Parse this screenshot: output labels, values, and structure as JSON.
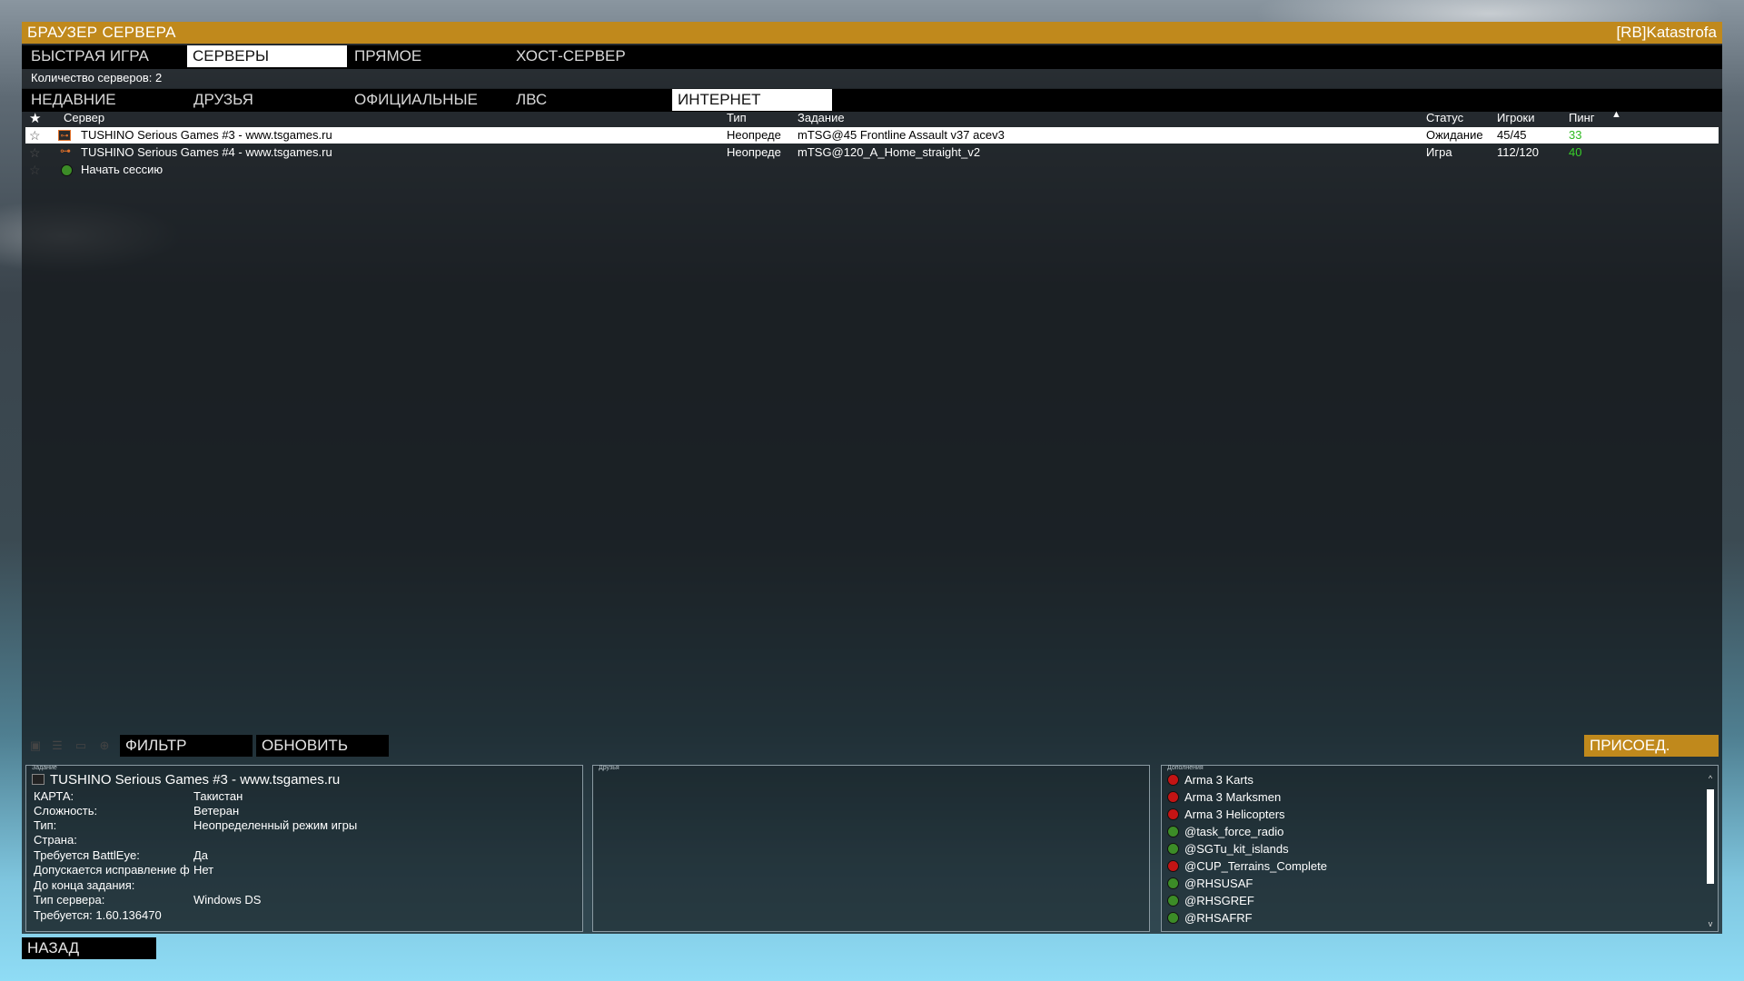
{
  "window": {
    "title": "БРАУЗЕР СЕРВЕРА",
    "user": "[RB]Katastrofa",
    "accent": "#c0891c"
  },
  "top_tabs": [
    {
      "label": "БЫСТРАЯ ИГРА",
      "active": false
    },
    {
      "label": "СЕРВЕРЫ",
      "active": true
    },
    {
      "label": "ПРЯМОЕ",
      "active": false
    },
    {
      "label": "ХОСТ-СЕРВЕР",
      "active": false
    }
  ],
  "server_count": "Количество серверов: 2",
  "source_tabs": [
    {
      "label": "НЕДАВНИЕ",
      "active": false
    },
    {
      "label": "ДРУЗЬЯ",
      "active": false
    },
    {
      "label": "ОФИЦИАЛЬНЫЕ",
      "active": false
    },
    {
      "label": "ЛВС",
      "active": false
    },
    {
      "label": "ИНТЕРНЕТ",
      "active": true
    }
  ],
  "columns": {
    "favorite_icon": "star-icon",
    "server": "Сервер",
    "type": "Тип",
    "mission": "Задание",
    "status": "Статус",
    "players": "Игроки",
    "ping": "Пинг",
    "sort_icon": "triangle-up-icon"
  },
  "servers": [
    {
      "name": "TUSHINO Serious Games #3 - www.tsgames.ru",
      "type": "Неопреде",
      "mission": "mTSG@45 Frontline Assault v37 acev3",
      "status": "Ожидание",
      "players": "45/45",
      "ping": "33",
      "locked": true,
      "selected": true
    },
    {
      "name": "TUSHINO Serious Games #4 - www.tsgames.ru",
      "type": "Неопреде",
      "mission": "mTSG@120_A_Home_straight_v2",
      "status": "Игра",
      "players": "112/120",
      "ping": "40",
      "locked": true,
      "selected": false
    }
  ],
  "start_session": "Начать сессию",
  "toolbar": {
    "filter": "ФИЛЬТР",
    "refresh": "ОБНОВИТЬ",
    "join": "ПРИСОЕД."
  },
  "details": {
    "legend": "Задание",
    "server_name": "TUSHINO Serious Games #3 - www.tsgames.ru",
    "rows": [
      {
        "k": "КАРТА:",
        "v": "Такистан"
      },
      {
        "k": "Сложность:",
        "v": "Ветеран"
      },
      {
        "k": "Тип:",
        "v": "Неопределенный режим игры"
      },
      {
        "k": "Страна:",
        "v": ""
      },
      {
        "k": "Требуется BattlEye:",
        "v": "Да"
      },
      {
        "k": "Допускается исправление ф",
        "v": "Нет"
      },
      {
        "k": "До конца задания:",
        "v": ""
      },
      {
        "k": "Тип сервера:",
        "v": "Windows DS"
      },
      {
        "k": "Требуется: 1.60.136470",
        "v": ""
      }
    ]
  },
  "friends": {
    "legend": "Друзья"
  },
  "addons": {
    "legend": "Дополнения",
    "items": [
      {
        "name": "Arma 3 Karts",
        "status": "red"
      },
      {
        "name": "Arma 3 Marksmen",
        "status": "red"
      },
      {
        "name": "Arma 3 Helicopters",
        "status": "red"
      },
      {
        "name": "@task_force_radio",
        "status": "green"
      },
      {
        "name": "@SGTu_kit_islands",
        "status": "green"
      },
      {
        "name": "@CUP_Terrains_Complete",
        "status": "red"
      },
      {
        "name": "@RHSUSAF",
        "status": "green"
      },
      {
        "name": "@RHSGREF",
        "status": "green"
      },
      {
        "name": "@RHSAFRF",
        "status": "green"
      }
    ]
  },
  "back": "НАЗАД"
}
